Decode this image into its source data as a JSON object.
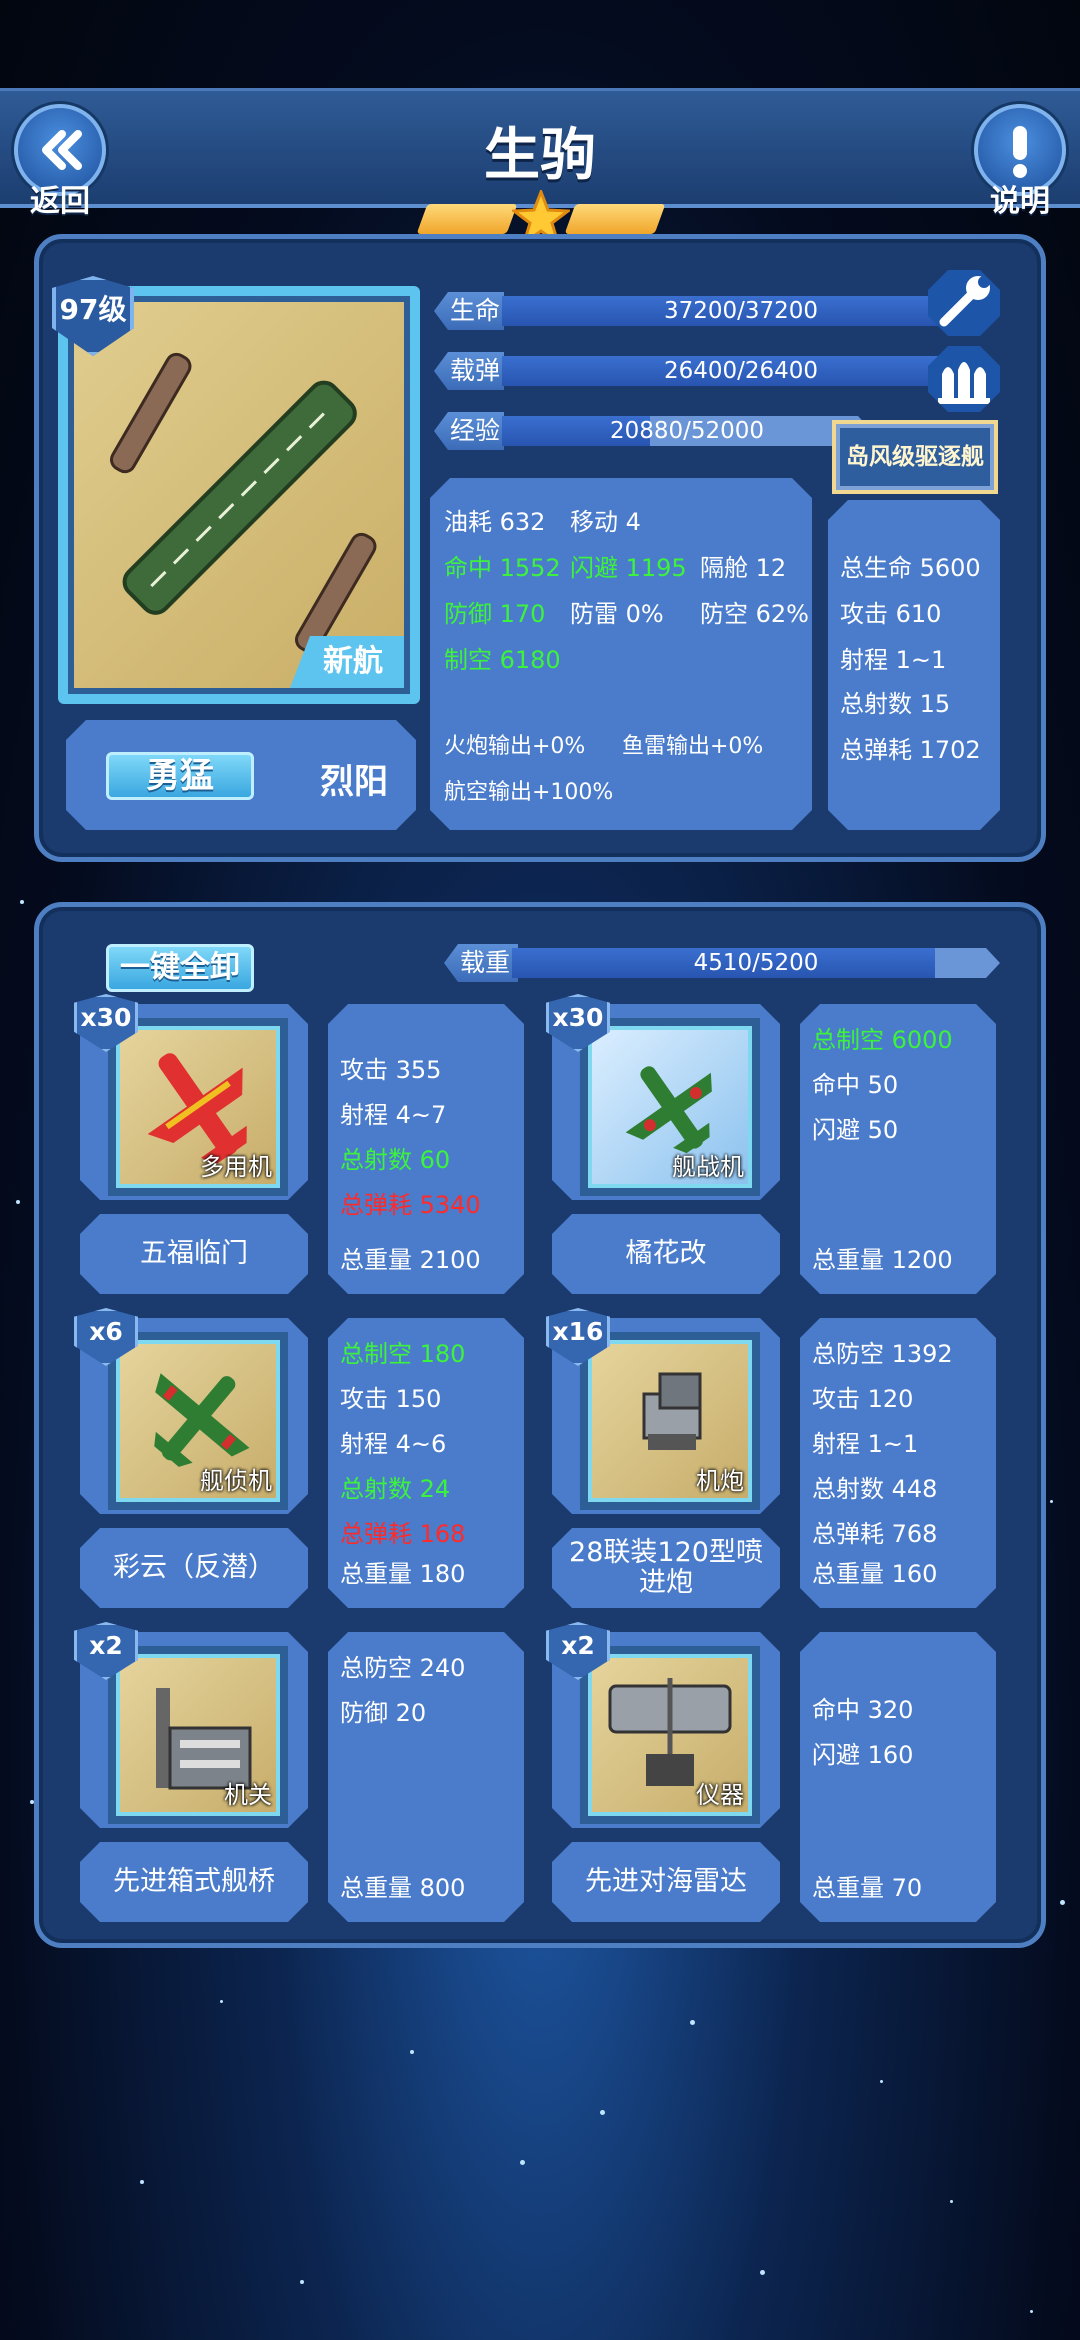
{
  "header": {
    "title": "生驹",
    "back_label": "返回",
    "help_label": "说明",
    "stars": 1
  },
  "ship": {
    "level": "97级",
    "type_tag": "新航",
    "traits": [
      "勇猛",
      "烈阳"
    ],
    "class_label": "岛风级驱逐舰",
    "bars": [
      {
        "label": "生命",
        "value": "37200/37200",
        "fill": 1.0
      },
      {
        "label": "载弹",
        "value": "26400/26400",
        "fill": 1.0
      },
      {
        "label": "经验",
        "value": "20880/52000",
        "fill": 0.4
      }
    ],
    "stats": {
      "fuel": "油耗 632",
      "move": "移动 4",
      "hit": "命中 1552",
      "evade": "闪避 1195",
      "bulkhead": "隔舱 12",
      "defense": "防御 170",
      "torp_def": "防雷 0%",
      "aa": "防空 62%",
      "air": "制空 6180",
      "gun_out": "火炮输出+0%",
      "torp_out": "鱼雷输出+0%",
      "air_out": "航空输出+100%"
    },
    "totals": [
      "总生命 5600",
      "攻击 610",
      "射程 1~1",
      "总射数 15",
      "总弹耗 1702"
    ]
  },
  "equip": {
    "unload_label": "一键全卸",
    "load_label": "载重",
    "load_value": "4510/5200",
    "load_fill": 0.867,
    "slots": [
      {
        "count": "x30",
        "type": "多用机",
        "name": "五福临门",
        "stats": [
          {
            "t": "攻击 355",
            "c": ""
          },
          {
            "t": "射程 4~7",
            "c": ""
          },
          {
            "t": "总射数 60",
            "c": "g"
          },
          {
            "t": "总弹耗 5340",
            "c": "r"
          },
          {
            "t": "总重量 2100",
            "c": ""
          }
        ]
      },
      {
        "count": "x30",
        "type": "舰战机",
        "name": "橘花改",
        "stats": [
          {
            "t": "总制空 6000",
            "c": "g"
          },
          {
            "t": "命中 50",
            "c": ""
          },
          {
            "t": "闪避 50",
            "c": ""
          },
          {
            "t": "",
            "c": ""
          },
          {
            "t": "总重量 1200",
            "c": ""
          }
        ]
      },
      {
        "count": "x6",
        "type": "舰侦机",
        "name": "彩云（反潜）",
        "stats": [
          {
            "t": "总制空 180",
            "c": "g"
          },
          {
            "t": "攻击 150",
            "c": ""
          },
          {
            "t": "射程 4~6",
            "c": ""
          },
          {
            "t": "总射数 24",
            "c": "g"
          },
          {
            "t": "总弹耗 168",
            "c": "r"
          },
          {
            "t": "总重量 180",
            "c": ""
          }
        ]
      },
      {
        "count": "x16",
        "type": "机炮",
        "name": "28联装120型喷进炮",
        "stats": [
          {
            "t": "总防空 1392",
            "c": ""
          },
          {
            "t": "攻击 120",
            "c": ""
          },
          {
            "t": "射程 1~1",
            "c": ""
          },
          {
            "t": "总射数 448",
            "c": ""
          },
          {
            "t": "总弹耗 768",
            "c": ""
          },
          {
            "t": "总重量 160",
            "c": ""
          }
        ]
      },
      {
        "count": "x2",
        "type": "机关",
        "name": "先进箱式舰桥",
        "stats": [
          {
            "t": "总防空 240",
            "c": ""
          },
          {
            "t": "防御 20",
            "c": ""
          },
          {
            "t": "总重量 800",
            "c": ""
          }
        ]
      },
      {
        "count": "x2",
        "type": "仪器",
        "name": "先进对海雷达",
        "stats": [
          {
            "t": "命中 320",
            "c": ""
          },
          {
            "t": "闪避 160",
            "c": ""
          },
          {
            "t": "总重量 70",
            "c": ""
          }
        ]
      }
    ]
  }
}
